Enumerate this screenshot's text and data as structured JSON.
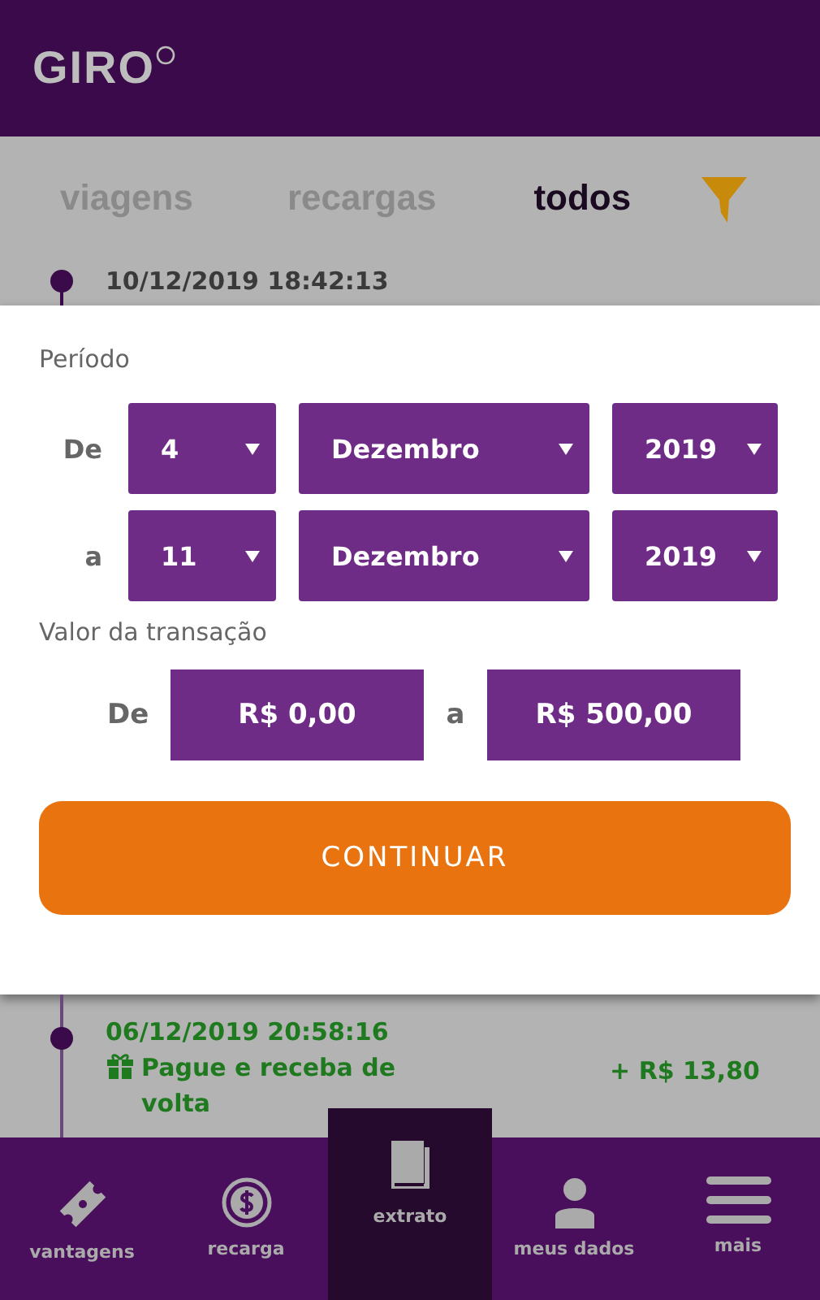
{
  "header": {
    "logo": "GIRO"
  },
  "tabs": [
    {
      "label": "viagens",
      "selected": false
    },
    {
      "label": "recargas",
      "selected": false
    },
    {
      "label": "todos",
      "selected": true
    }
  ],
  "timeline_top": {
    "datetime": "10/12/2019 18:42:13"
  },
  "filter_panel": {
    "period_label": "Período",
    "date_rows": [
      {
        "label": "De",
        "day": "4",
        "month": "Dezembro",
        "year": "2019"
      },
      {
        "label": "a",
        "day": "11",
        "month": "Dezembro",
        "year": "2019"
      }
    ],
    "value_label": "Valor da transação",
    "value_from_label": "De",
    "value_from": "R$ 0,00",
    "value_to_label": "a",
    "value_to": "R$ 500,00",
    "button": "CONTINUAR"
  },
  "timeline_bottom": {
    "datetime": "06/12/2019 20:58:16",
    "description": "Pague e receba de volta",
    "amount": "+ R$ 13,80"
  },
  "nav": [
    {
      "kind": "ticket",
      "label": "vantagens",
      "selected": false
    },
    {
      "kind": "dollar",
      "label": "recarga",
      "selected": false
    },
    {
      "kind": "book",
      "label": "extrato",
      "selected": true
    },
    {
      "kind": "person",
      "label": "meus dados",
      "selected": false
    },
    {
      "kind": "menu",
      "label": "mais",
      "selected": false
    }
  ]
}
